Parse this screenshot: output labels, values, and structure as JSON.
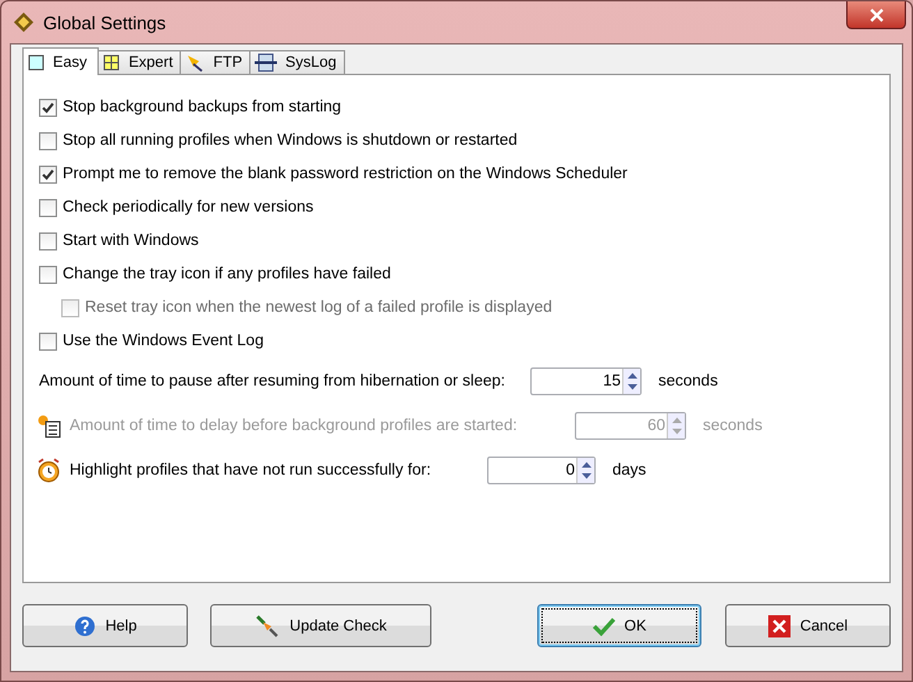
{
  "window": {
    "title": "Global Settings"
  },
  "tabs": [
    {
      "label": "Easy",
      "selected": true
    },
    {
      "label": "Expert",
      "selected": false
    },
    {
      "label": "FTP",
      "selected": false
    },
    {
      "label": "SysLog",
      "selected": false
    }
  ],
  "options": [
    {
      "label": "Stop background backups from starting",
      "checked": true,
      "disabled": false
    },
    {
      "label": "Stop all running profiles when Windows is shutdown or restarted",
      "checked": false,
      "disabled": false
    },
    {
      "label": "Prompt me to remove the blank password restriction on the Windows Scheduler",
      "checked": true,
      "disabled": false
    },
    {
      "label": "Check periodically for new versions",
      "checked": false,
      "disabled": false
    },
    {
      "label": "Start with Windows",
      "checked": false,
      "disabled": false
    },
    {
      "label": "Change the tray icon if any profiles have failed",
      "checked": false,
      "disabled": false,
      "children": [
        {
          "label": "Reset tray icon when the newest log of a failed profile is displayed",
          "checked": false,
          "disabled": true
        }
      ]
    },
    {
      "label": "Use the Windows Event Log",
      "checked": false,
      "disabled": false
    }
  ],
  "spinners": [
    {
      "label": "Amount of time to pause after resuming from hibernation or sleep:",
      "value": "15",
      "unit": "seconds",
      "disabled": false
    },
    {
      "label": "Amount of time to delay before background profiles are started:",
      "value": "60",
      "unit": "seconds",
      "disabled": true
    },
    {
      "label": "Highlight profiles that have not run successfully for:",
      "value": "0",
      "unit": "days",
      "disabled": false
    }
  ],
  "buttons": [
    {
      "label": "Help",
      "default": false
    },
    {
      "label": "Update Check",
      "default": false
    },
    {
      "label": "OK",
      "default": true
    },
    {
      "label": "Cancel",
      "default": false
    }
  ]
}
